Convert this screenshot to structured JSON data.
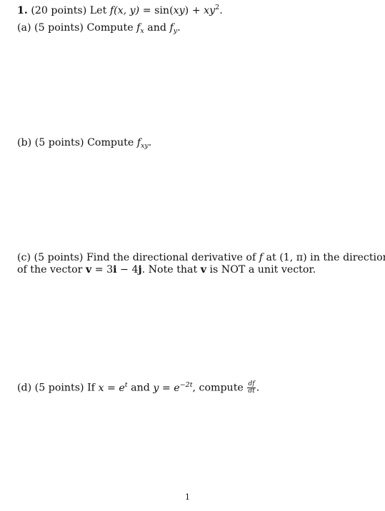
{
  "problem": {
    "number": "1.",
    "points": "(20 points)",
    "intro": "Let",
    "function_def": {
      "lhs_f": "f",
      "lhs_args": "(x, y)",
      "equals": " = ",
      "sin": "sin(",
      "xy": "xy",
      "close": ")",
      "plus": " + ",
      "xy2_base": "xy",
      "xy2_exp": "2",
      "period": "."
    }
  },
  "parts": [
    {
      "label": "(a)",
      "points": "(5 points)",
      "text": "Compute",
      "f1": "f",
      "f1_sub": "x",
      "and": "and",
      "f2": "f",
      "f2_sub": "y",
      "end": "."
    },
    {
      "label": "(b)",
      "points": "(5 points)",
      "text": "Compute",
      "f": "f",
      "f_sub": "xy",
      "end": "."
    },
    {
      "label": "(c)",
      "points": "(5 points)",
      "line1_a": "Find the directional derivative of",
      "f": "f",
      "at": "at",
      "point": "(1, π)",
      "line1_b": "in the direction",
      "line2_a": "of the vector",
      "v": "v",
      "eq": " = 3",
      "i": "i",
      "minus": " − 4",
      "j": "j",
      "line2_b": ". Note that",
      "v2": "v",
      "line2_c": "is NOT a unit vector."
    },
    {
      "label": "(d)",
      "points": "(5 points)",
      "if": "If",
      "x": "x",
      "eq1": " = ",
      "e1": "e",
      "e1_exp": "t",
      "and": "and",
      "y": "y",
      "eq2": " = ",
      "e2": "e",
      "e2_exp": "−2t",
      "compute": ", compute",
      "frac_num": "df",
      "frac_den": "dt",
      "end": "."
    }
  ],
  "footer": {
    "page_number": "1"
  }
}
